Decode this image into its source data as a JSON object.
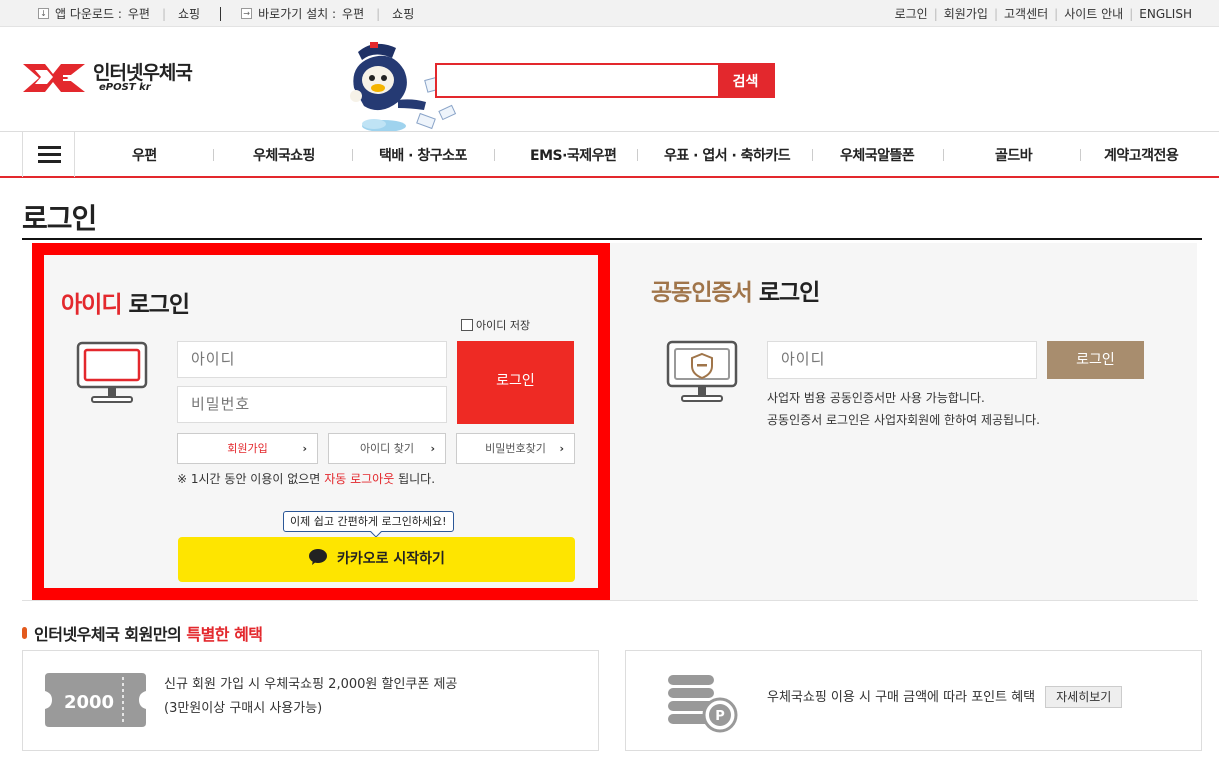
{
  "topbar": {
    "app_download_label": "앱 다운로드 :",
    "app_post": "우편",
    "app_shop": "쇼핑",
    "shortcut_label": "바로가기 설치 :",
    "shortcut_post": "우편",
    "shortcut_shop": "쇼핑",
    "right_links": [
      "로그인",
      "회원가입",
      "고객센터",
      "사이트 안내",
      "ENGLISH"
    ]
  },
  "logo": {
    "korean": "인터넷우체국",
    "english": "ePOST kr"
  },
  "search": {
    "button": "검색",
    "value": ""
  },
  "gnb": {
    "items": [
      "우편",
      "우체국쇼핑",
      "택배 · 창구소포",
      "EMS·국제우편",
      "우표 · 엽서 · 축하카드",
      "우체국알뜰폰",
      "골드바",
      "계약고객전용"
    ]
  },
  "page_title": "로그인",
  "id_login": {
    "title_highlight": "아이디",
    "title_rest": "로그인",
    "save_id_label": "아이디 저장",
    "id_placeholder": "아이디",
    "pw_placeholder": "비밀번호",
    "login_button": "로그인",
    "signup_button": "회원가입",
    "find_id_button": "아이디 찾기",
    "find_pw_button": "비밀번호찾기",
    "notice_pre": "※ 1시간 동안 이용이 없으면",
    "notice_red": "자동 로그아웃",
    "notice_post": "됩니다.",
    "kakao_tip": "이제 쉽고 간편하게 로그인하세요!",
    "kakao_button": "카카오로 시작하기"
  },
  "cert_login": {
    "title_highlight": "공동인증서",
    "title_rest": "로그인",
    "id_placeholder": "아이디",
    "login_button": "로그인",
    "desc1": "사업자 범용 공동인증서만 사용 가능합니다.",
    "desc2": "공동인증서 로그인은 사업자회원에 한하여 제공됩니다."
  },
  "benefits": {
    "title_pre": "인터넷우체국 회원만의",
    "title_red": "특별한 혜택",
    "coupon_value": "2000",
    "card1_line1": "신규 회원 가입 시 우체국쇼핑 2,000원 할인쿠폰 제공",
    "card1_line2": "(3만원이상 구매시 사용가능)",
    "card2_text": "우체국쇼핑 이용 시 구매 금액에 따라 포인트 혜택",
    "card2_button": "자세히보기"
  },
  "colors": {
    "brand_red": "#e3282d",
    "kakao_yellow": "#fee500",
    "cert_brown": "#a0754a"
  }
}
